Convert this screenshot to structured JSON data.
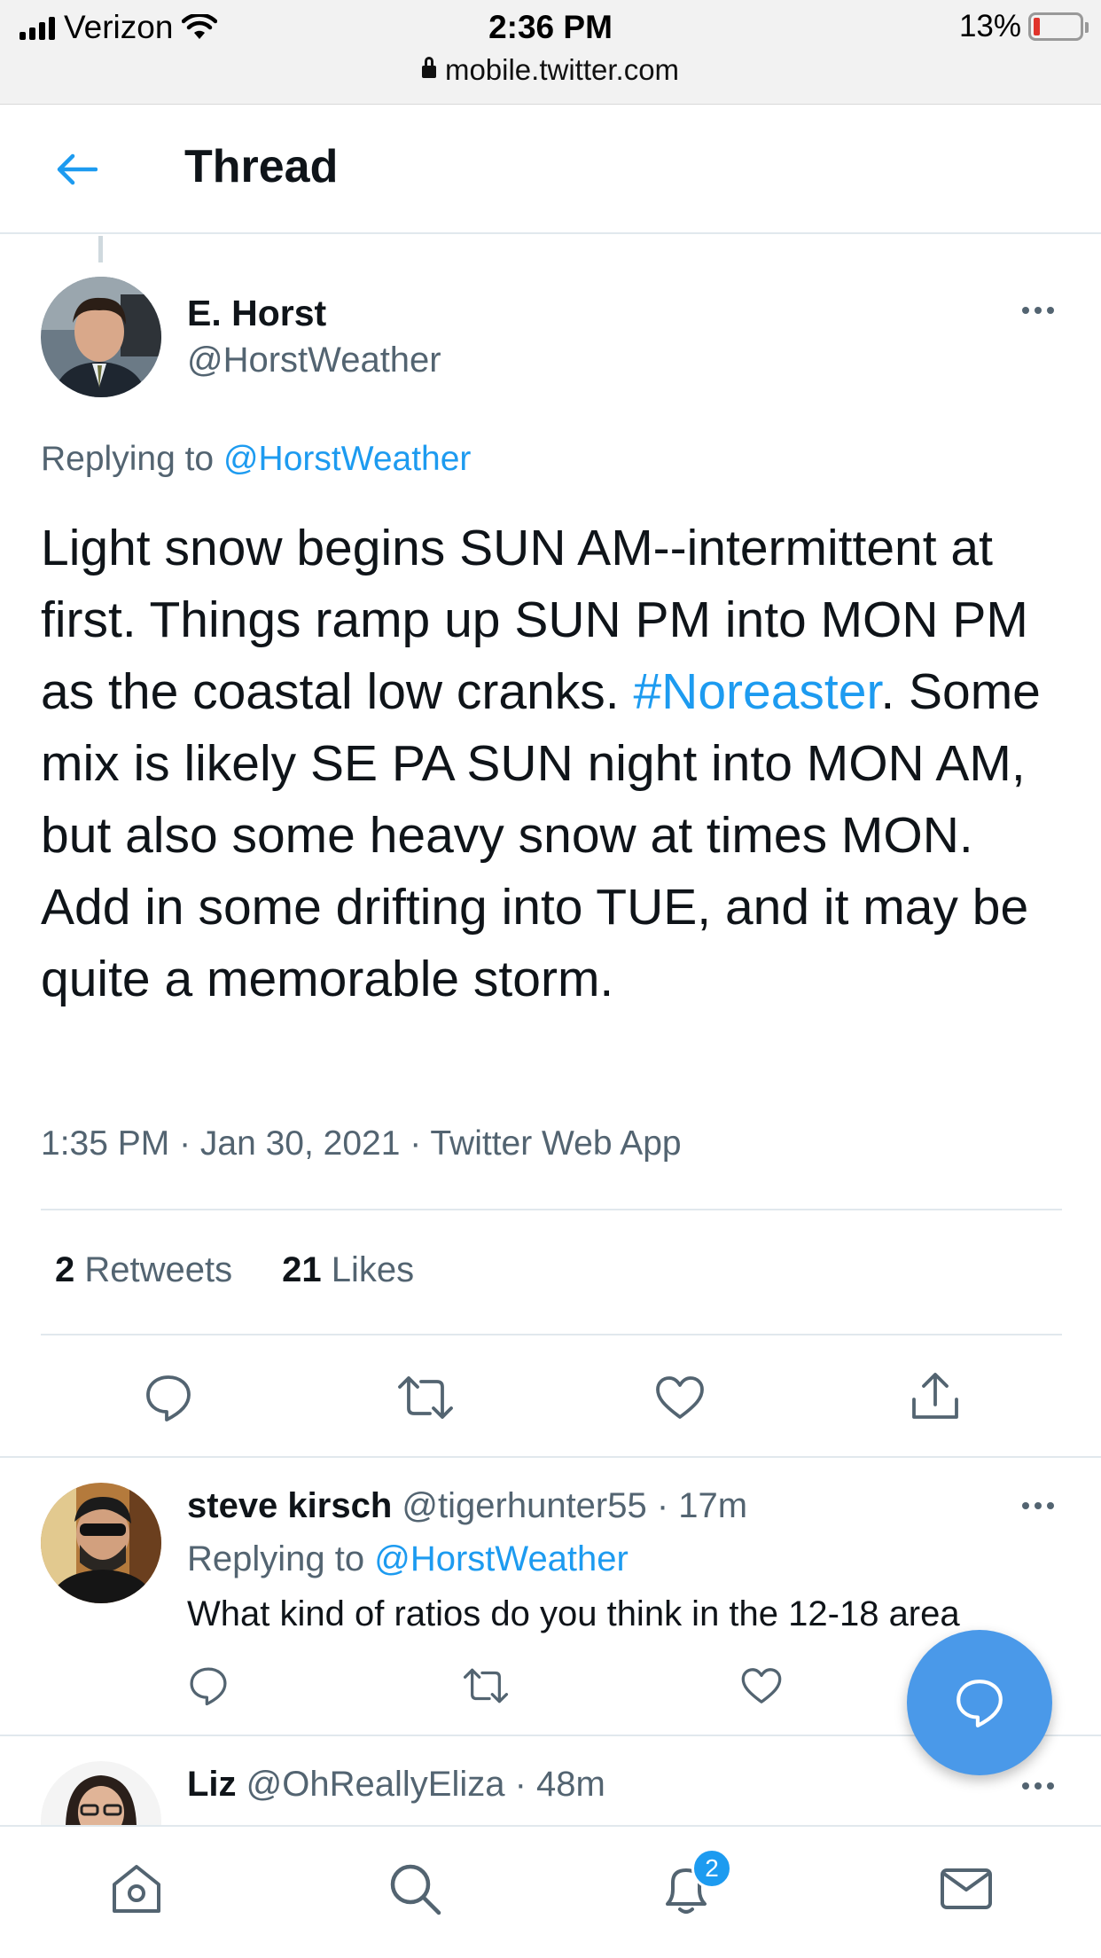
{
  "status_bar": {
    "carrier": "Verizon",
    "time": "2:36 PM",
    "url": "mobile.twitter.com",
    "battery": "13%"
  },
  "header": {
    "title": "Thread"
  },
  "main_tweet": {
    "name": "E. Horst",
    "handle": "@HorstWeather",
    "replying_prefix": "Replying to ",
    "replying_handle": "@HorstWeather",
    "text_part1": "Light snow begins SUN AM--intermittent at first. Things ramp up SUN PM into MON PM as the coastal low cranks. ",
    "hashtag": "#Noreaster",
    "text_part2": ". Some mix is likely SE PA SUN night into MON AM, but also some heavy snow at times MON. Add in some drifting into TUE, and it may be quite a memorable storm.",
    "timestamp": "1:35 PM · Jan 30, 2021 · Twitter Web App",
    "retweets_count": "2",
    "retweets_label": " Retweets",
    "likes_count": "21",
    "likes_label": " Likes"
  },
  "replies": [
    {
      "name": "steve kirsch",
      "handle": "@tigerhunter55 · 17m",
      "replying_prefix": "Replying to ",
      "replying_handle": "@HorstWeather",
      "text": "What kind of ratios do you think in the 12-18 area"
    },
    {
      "name": "Liz",
      "handle": "@OhReallyEliza · 48m"
    }
  ],
  "notifications_badge": "2",
  "colors": {
    "accent": "#1d9bf0",
    "text_secondary": "#536471",
    "fab": "#4a99e9"
  }
}
